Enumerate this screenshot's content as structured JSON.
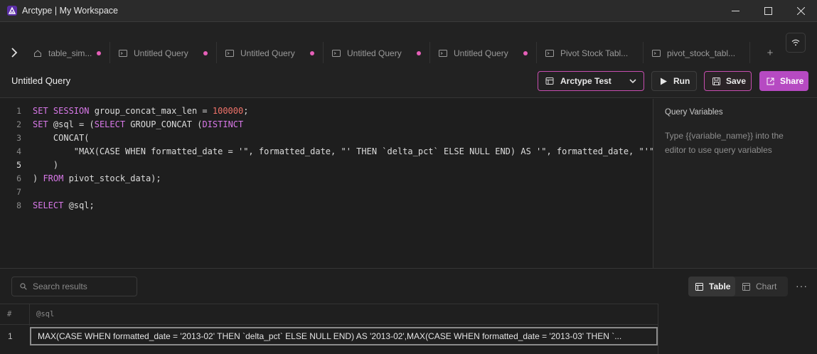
{
  "window": {
    "title": "Arctype | My Workspace"
  },
  "tabs": [
    {
      "label": "table_sim...",
      "icon": "home-icon",
      "modified": true
    },
    {
      "label": "Untitled Query",
      "icon": "terminal-icon",
      "modified": true
    },
    {
      "label": "Untitled Query",
      "icon": "terminal-icon",
      "modified": true
    },
    {
      "label": "Untitled Query",
      "icon": "terminal-icon",
      "modified": true
    },
    {
      "label": "Untitled Query",
      "icon": "terminal-icon",
      "modified": true
    },
    {
      "label": "Pivot Stock Tabl...",
      "icon": "terminal-icon",
      "modified": false
    },
    {
      "label": "pivot_stock_tabl...",
      "icon": "terminal-icon",
      "modified": false
    }
  ],
  "tab_add_label": "+",
  "query": {
    "title": "Untitled Query",
    "database": "Arctype Test",
    "run_label": "Run",
    "save_label": "Save",
    "share_label": "Share"
  },
  "editor": {
    "line_numbers": [
      "1",
      "2",
      "3",
      "4",
      "5",
      "6",
      "7",
      "8"
    ],
    "current_line": 5,
    "lines": [
      [
        {
          "t": "SET SESSION",
          "c": "kw"
        },
        {
          "t": " group_concat_max_len = ",
          "c": ""
        },
        {
          "t": "100000",
          "c": "num"
        },
        {
          "t": ";",
          "c": ""
        }
      ],
      [
        {
          "t": "SET",
          "c": "kw"
        },
        {
          "t": " @sql = (",
          "c": ""
        },
        {
          "t": "SELECT",
          "c": "kw"
        },
        {
          "t": " GROUP_CONCAT (",
          "c": ""
        },
        {
          "t": "DISTINCT",
          "c": "kw"
        }
      ],
      [
        {
          "t": "    CONCAT(",
          "c": ""
        }
      ],
      [
        {
          "t": "        \"MAX(CASE WHEN formatted_date = '\", formatted_date, \"' THEN `delta_pct` ELSE NULL END) AS '\", formatted_date, \"'\"",
          "c": "str"
        }
      ],
      [
        {
          "t": "    )",
          "c": ""
        }
      ],
      [
        {
          "t": ") ",
          "c": ""
        },
        {
          "t": "FROM",
          "c": "kw"
        },
        {
          "t": " pivot_stock_data);",
          "c": ""
        }
      ],
      [],
      [
        {
          "t": "SELECT",
          "c": "kw"
        },
        {
          "t": " @sql;",
          "c": ""
        }
      ]
    ]
  },
  "variables_panel": {
    "title": "Query Variables",
    "hint": "Type {{variable_name}} into the editor to use query variables"
  },
  "results": {
    "search_placeholder": "Search results",
    "view_table_label": "Table",
    "view_chart_label": "Chart",
    "more_label": "···",
    "columns": [
      "#",
      "@sql"
    ],
    "rows": [
      {
        "index": "1",
        "value": "MAX(CASE WHEN formatted_date = '2013-02' THEN `delta_pct` ELSE NULL END) AS '2013-02',MAX(CASE WHEN formatted_date = '2013-03' THEN `..."
      }
    ]
  },
  "colors": {
    "accent": "#c74eb0",
    "share_bg": "#b64ac2",
    "keyword": "#d878e8",
    "number": "#f0736a",
    "modified_dot": "#e55fb8"
  }
}
